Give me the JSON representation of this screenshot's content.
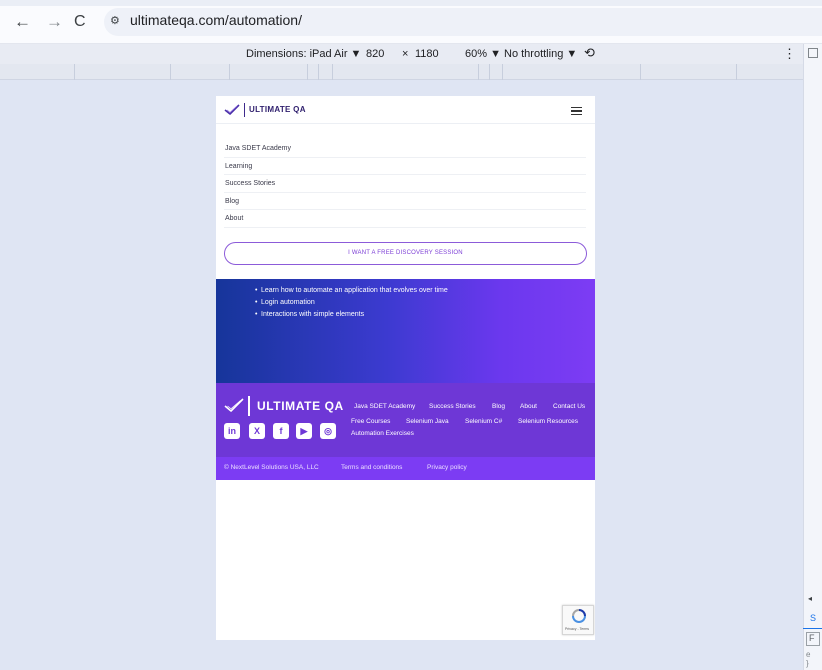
{
  "browser": {
    "back_icon": "←",
    "forward_icon": "→",
    "reload_icon": "C",
    "site_settings_icon": "⚙",
    "url": "ultimateqa.com/automation/"
  },
  "device_toolbar": {
    "dimensions_label": "Dimensions: iPad Air ▼",
    "width": "820",
    "times": "×",
    "height": "1180",
    "zoom": "60% ▼",
    "throttling": "No throttling ▼",
    "rotate_icon": "⟲",
    "more_icon": "⋮"
  },
  "devtools_edge": {
    "scroll_glyph": "◂",
    "s_tab": "S",
    "f_box": "F",
    "small_text": "e\n}"
  },
  "site": {
    "logo_text": "ULTIMATE QA",
    "menu_items": [
      "Java SDET Academy",
      "Learning",
      "Success Stories",
      "Blog",
      "About"
    ],
    "cta_label": "I WANT A FREE DISCOVERY SESSION",
    "hero_items": [
      "Learn how to automate an application that evolves over time",
      "Login automation",
      "Interactions with simple elements"
    ],
    "footer": {
      "logo_text": "ULTIMATE QA",
      "row1": [
        "Java SDET Academy",
        "Success Stories",
        "Blog",
        "About",
        "Contact Us"
      ],
      "row2": [
        "Free Courses",
        "Selenium Java",
        "Selenium C#",
        "Selenium Resources"
      ],
      "row3": [
        "Automation Exercises"
      ],
      "social": [
        "in",
        "X",
        "f",
        "▶",
        "◎"
      ]
    },
    "legal": {
      "copyright": "© NextLevel Solutions USA, LLC",
      "terms": "Terms and conditions",
      "privacy": "Privacy policy"
    },
    "recaptcha_text": "Privacy - Terms"
  },
  "colors": {
    "brand_purple": "#6e37d6",
    "legal_purple": "#7c3cf3",
    "hero_start": "#16359a",
    "hero_end": "#7d3cf4",
    "cta_border": "#8c5bd9"
  }
}
